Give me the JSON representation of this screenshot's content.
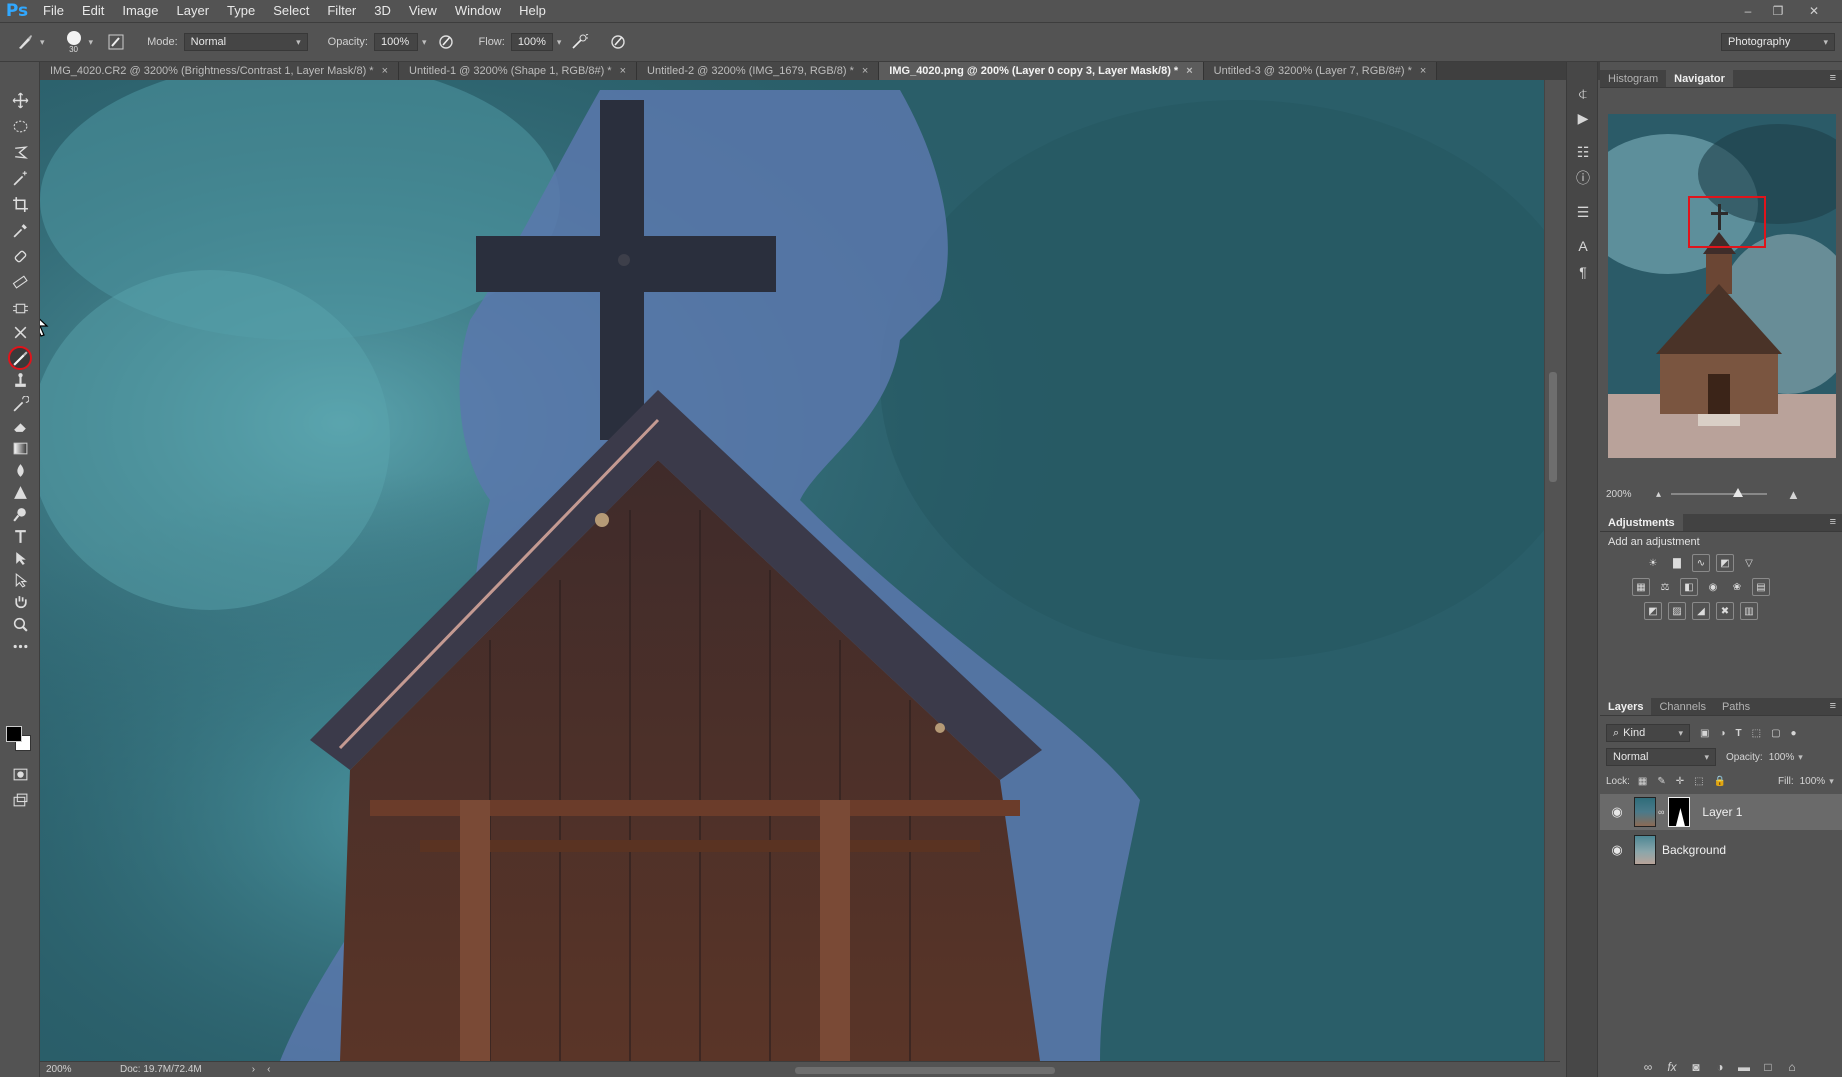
{
  "app": {
    "logo": "Ps"
  },
  "menu": [
    "File",
    "Edit",
    "Image",
    "Layer",
    "Type",
    "Select",
    "Filter",
    "3D",
    "View",
    "Window",
    "Help"
  ],
  "options": {
    "brush_size": "30",
    "mode_label": "Mode:",
    "mode_value": "Normal",
    "opacity_label": "Opacity:",
    "opacity_value": "100%",
    "flow_label": "Flow:",
    "flow_value": "100%",
    "workspace": "Photography"
  },
  "tabs": [
    {
      "label": "IMG_4020.CR2 @ 3200% (Brightness/Contrast 1, Layer Mask/8) *",
      "active": false
    },
    {
      "label": "Untitled-1 @ 3200% (Shape 1, RGB/8#) *",
      "active": false
    },
    {
      "label": "Untitled-2 @ 3200% (IMG_1679, RGB/8) *",
      "active": false
    },
    {
      "label": "IMG_4020.png @ 200% (Layer 0 copy 3, Layer Mask/8) *",
      "active": true
    },
    {
      "label": "Untitled-3 @ 3200% (Layer 7, RGB/8#) *",
      "active": false
    }
  ],
  "tab_close": "×",
  "status": {
    "zoom": "200%",
    "doc": "Doc: 19.7M/72.4M"
  },
  "navigator": {
    "tabs": [
      "Histogram",
      "Navigator"
    ],
    "active_tab": "Navigator",
    "zoom": "200%"
  },
  "adjustments": {
    "title": "Adjustments",
    "subtitle": "Add an adjustment"
  },
  "layers": {
    "tabs": [
      "Layers",
      "Channels",
      "Paths"
    ],
    "filter_kind": "Kind",
    "blend_mode": "Normal",
    "opacity_label": "Opacity:",
    "opacity_value": "100%",
    "lock_label": "Lock:",
    "fill_label": "Fill:",
    "fill_value": "100%",
    "items": [
      {
        "name": "Layer 1",
        "active": true,
        "has_mask": true
      },
      {
        "name": "Background",
        "active": false,
        "has_mask": false
      }
    ]
  },
  "colors": {
    "accent": "#31a8ff",
    "highlight": "#e0141b",
    "panel_bg": "#535353",
    "canvas_sky": "#2c6370"
  }
}
